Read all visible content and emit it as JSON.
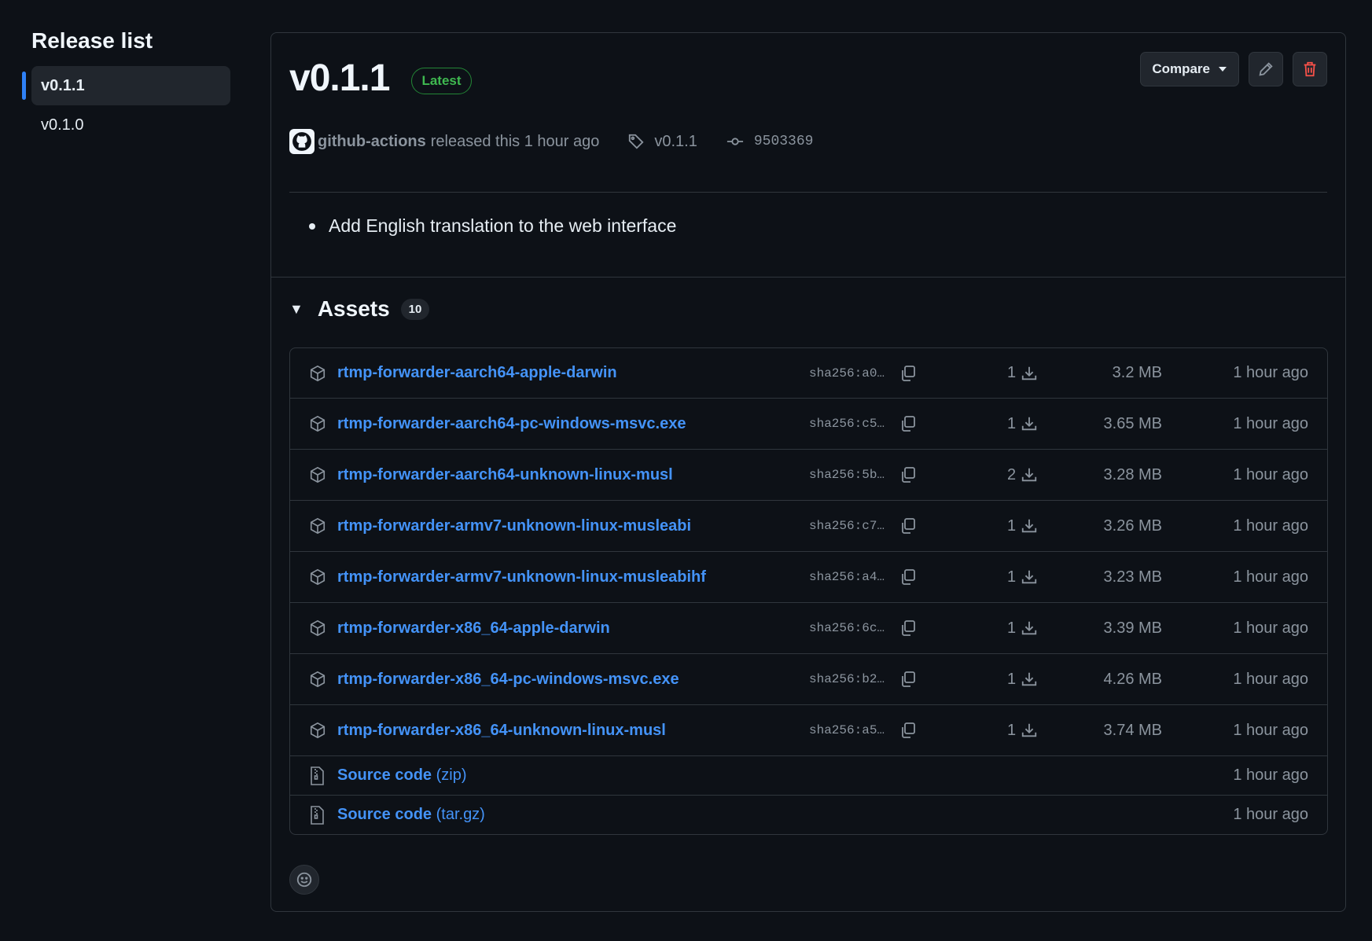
{
  "sidebar": {
    "title": "Release list",
    "items": [
      {
        "label": "v0.1.1",
        "active": true
      },
      {
        "label": "v0.1.0",
        "active": false
      }
    ]
  },
  "release": {
    "title": "v0.1.1",
    "badge": "Latest",
    "compare_label": "Compare",
    "author": "github-actions",
    "released_text": "released this 1 hour ago",
    "tag": "v0.1.1",
    "commit": "9503369",
    "notes": "Add English translation to the web interface"
  },
  "assets": {
    "title": "Assets",
    "count": "10",
    "files": [
      {
        "name": "rtmp-forwarder-aarch64-apple-darwin",
        "sha": "sha256:a0…",
        "downloads": "1",
        "size": "3.2 MB",
        "time": "1 hour ago"
      },
      {
        "name": "rtmp-forwarder-aarch64-pc-windows-msvc.exe",
        "sha": "sha256:c5…",
        "downloads": "1",
        "size": "3.65 MB",
        "time": "1 hour ago"
      },
      {
        "name": "rtmp-forwarder-aarch64-unknown-linux-musl",
        "sha": "sha256:5b…",
        "downloads": "2",
        "size": "3.28 MB",
        "time": "1 hour ago"
      },
      {
        "name": "rtmp-forwarder-armv7-unknown-linux-musleabi",
        "sha": "sha256:c7…",
        "downloads": "1",
        "size": "3.26 MB",
        "time": "1 hour ago"
      },
      {
        "name": "rtmp-forwarder-armv7-unknown-linux-musleabihf",
        "sha": "sha256:a4…",
        "downloads": "1",
        "size": "3.23 MB",
        "time": "1 hour ago"
      },
      {
        "name": "rtmp-forwarder-x86_64-apple-darwin",
        "sha": "sha256:6c…",
        "downloads": "1",
        "size": "3.39 MB",
        "time": "1 hour ago"
      },
      {
        "name": "rtmp-forwarder-x86_64-pc-windows-msvc.exe",
        "sha": "sha256:b2…",
        "downloads": "1",
        "size": "4.26 MB",
        "time": "1 hour ago"
      },
      {
        "name": "rtmp-forwarder-x86_64-unknown-linux-musl",
        "sha": "sha256:a5…",
        "downloads": "1",
        "size": "3.74 MB",
        "time": "1 hour ago"
      }
    ],
    "source": [
      {
        "name": "Source code",
        "ext": "(zip)",
        "time": "1 hour ago"
      },
      {
        "name": "Source code",
        "ext": "(tar.gz)",
        "time": "1 hour ago"
      }
    ]
  },
  "icons": {
    "package": "package-icon",
    "copy": "copy-icon",
    "download": "download-icon",
    "zip": "file-zip-icon",
    "tag": "tag-icon",
    "commit": "commit-icon",
    "pencil": "pencil-icon",
    "trash": "trash-icon",
    "smiley": "smiley-icon"
  },
  "colors": {
    "link": "#4493f8",
    "latest": "#3fb950",
    "danger": "#f85149",
    "accent": "#2f81f7"
  }
}
